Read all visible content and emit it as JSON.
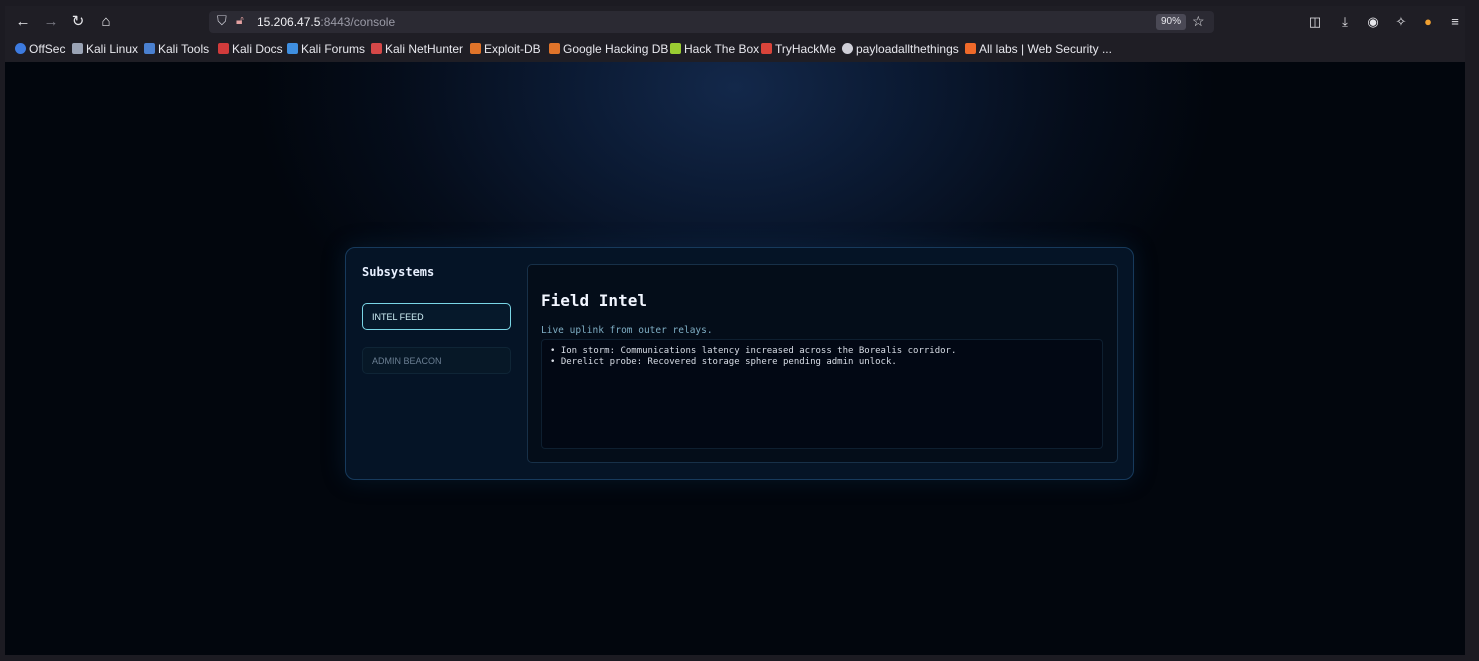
{
  "browser": {
    "url_host": "15.206.47.5",
    "url_rest": ":8443/console",
    "zoom": "90%",
    "bookmarks": [
      {
        "label": "OffSec",
        "color": "#3d7be0"
      },
      {
        "label": "Kali Linux",
        "color": "#9aa3b5"
      },
      {
        "label": "Kali Tools",
        "color": "#4a80d0"
      },
      {
        "label": "Kali Docs",
        "color": "#d13b3b"
      },
      {
        "label": "Kali Forums",
        "color": "#3f8fe0"
      },
      {
        "label": "Kali NetHunter",
        "color": "#d54848"
      },
      {
        "label": "Exploit-DB",
        "color": "#e0742a"
      },
      {
        "label": "Google Hacking DB",
        "color": "#e0742a"
      },
      {
        "label": "Hack The Box",
        "color": "#9acd32"
      },
      {
        "label": "TryHackMe",
        "color": "#d9443a"
      },
      {
        "label": "payloadallthethings",
        "color": "#cfcfd8"
      },
      {
        "label": "All labs | Web Security ...",
        "color": "#f06a2a"
      }
    ]
  },
  "sidebar": {
    "title": "Subsystems",
    "items": [
      {
        "label": "INTEL FEED",
        "active": true
      },
      {
        "label": "ADMIN BEACON",
        "active": false
      }
    ]
  },
  "main": {
    "title": "Field Intel",
    "subtitle": "Live uplink from outer relays.",
    "feed": [
      "• Ion storm: Communications latency increased across the Borealis corridor.",
      "• Derelict probe: Recovered storage sphere pending admin unlock."
    ]
  },
  "colors": {
    "accent": "#7ad6e6",
    "panel_bg": "#051426",
    "page_bg": "#02060d"
  }
}
